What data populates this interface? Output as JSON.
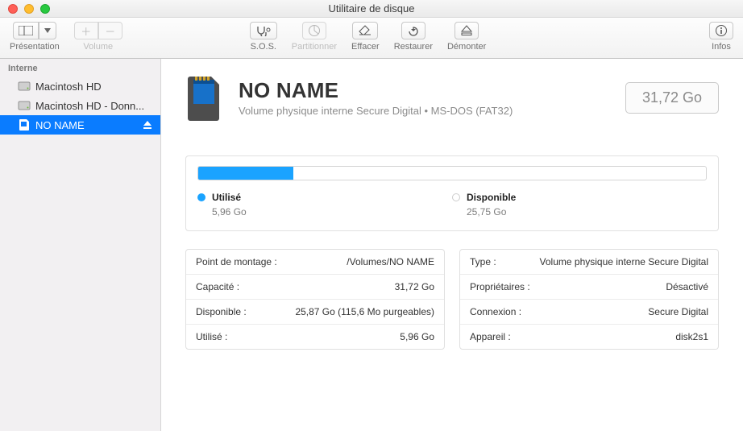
{
  "window": {
    "title": "Utilitaire de disque"
  },
  "toolbar": {
    "view_label": "Présentation",
    "volume_label": "Volume",
    "sos_label": "S.O.S.",
    "partition_label": "Partitionner",
    "erase_label": "Effacer",
    "restore_label": "Restaurer",
    "unmount_label": "Démonter",
    "info_label": "Infos"
  },
  "sidebar": {
    "header": "Interne",
    "items": [
      {
        "label": "Macintosh HD",
        "type": "hdd",
        "selected": false
      },
      {
        "label": "Macintosh HD - Donn...",
        "type": "hdd",
        "selected": false
      },
      {
        "label": "NO NAME",
        "type": "sd",
        "selected": true,
        "ejectable": true
      }
    ]
  },
  "volume": {
    "name": "NO NAME",
    "subtitle": "Volume physique interne Secure Digital • MS-DOS (FAT32)",
    "capacity_display": "31,72 Go"
  },
  "usage": {
    "used_label": "Utilisé",
    "used_value": "5,96 Go",
    "free_label": "Disponible",
    "free_value": "25,75 Go",
    "used_percent": 18.8
  },
  "details": {
    "left": [
      {
        "k": "Point de montage :",
        "v": "/Volumes/NO NAME"
      },
      {
        "k": "Capacité :",
        "v": "31,72 Go"
      },
      {
        "k": "Disponible :",
        "v": "25,87 Go (115,6 Mo purgeables)"
      },
      {
        "k": "Utilisé :",
        "v": "5,96 Go"
      }
    ],
    "right": [
      {
        "k": "Type :",
        "v": "Volume physique interne Secure Digital"
      },
      {
        "k": "Propriétaires :",
        "v": "Désactivé"
      },
      {
        "k": "Connexion :",
        "v": "Secure Digital"
      },
      {
        "k": "Appareil :",
        "v": "disk2s1"
      }
    ]
  }
}
